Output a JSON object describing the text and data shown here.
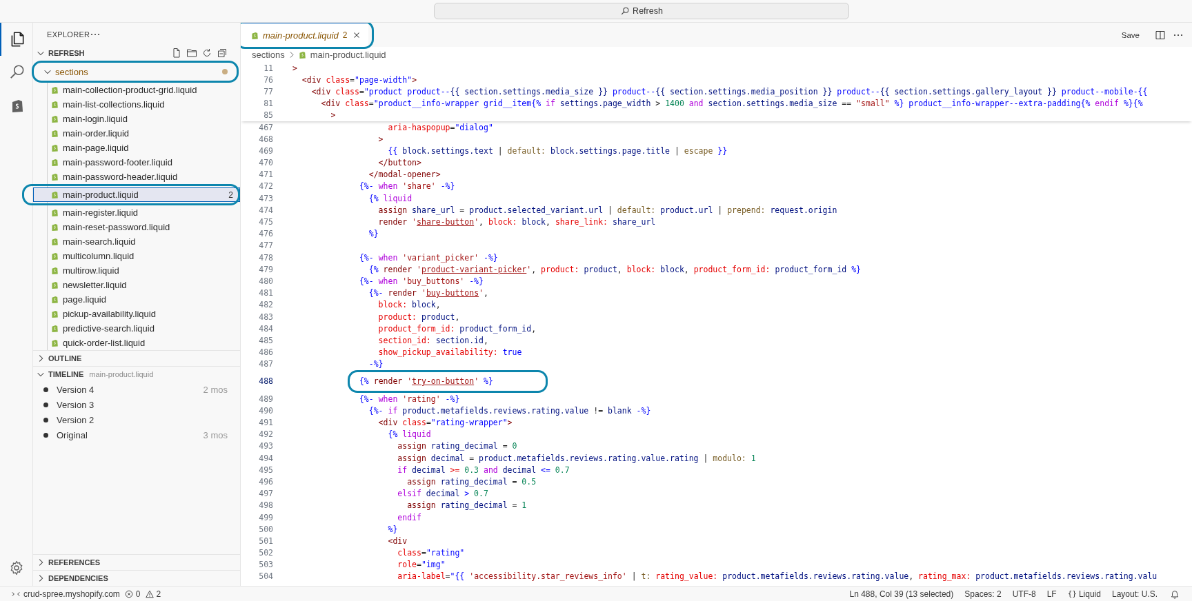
{
  "title_bar": {
    "command_center": "Refresh"
  },
  "activity_bar": {
    "items": [
      {
        "kind": "files",
        "selected": true
      },
      {
        "kind": "search",
        "selected": false
      },
      {
        "kind": "shopify",
        "selected": false
      }
    ]
  },
  "explorer": {
    "title": "EXPLORER",
    "root": {
      "label": "REFRESH",
      "expanded": true
    },
    "folder": {
      "label": "sections",
      "expanded": true,
      "modified": true,
      "circled": true
    },
    "files": [
      {
        "name": "main-collection-product-grid.liquid",
        "selected": false,
        "circled": false
      },
      {
        "name": "main-list-collections.liquid",
        "selected": false,
        "circled": false
      },
      {
        "name": "main-login.liquid",
        "selected": false,
        "circled": false
      },
      {
        "name": "main-order.liquid",
        "selected": false,
        "circled": false
      },
      {
        "name": "main-page.liquid",
        "selected": false,
        "circled": false
      },
      {
        "name": "main-password-footer.liquid",
        "selected": false,
        "circled": false
      },
      {
        "name": "main-password-header.liquid",
        "selected": false,
        "circled": false
      },
      {
        "name": "main-product.liquid",
        "problems": "2",
        "selected": true,
        "circled": true
      },
      {
        "name": "main-register.liquid",
        "selected": false,
        "circled": false
      },
      {
        "name": "main-reset-password.liquid",
        "selected": false,
        "circled": false
      },
      {
        "name": "main-search.liquid",
        "selected": false,
        "circled": false
      },
      {
        "name": "multicolumn.liquid",
        "selected": false,
        "circled": false
      },
      {
        "name": "multirow.liquid",
        "selected": false,
        "circled": false
      },
      {
        "name": "newsletter.liquid",
        "selected": false,
        "circled": false
      },
      {
        "name": "page.liquid",
        "selected": false,
        "circled": false
      },
      {
        "name": "pickup-availability.liquid",
        "selected": false,
        "circled": false
      },
      {
        "name": "predictive-search.liquid",
        "selected": false,
        "circled": false
      },
      {
        "name": "quick-order-list.liquid",
        "selected": false,
        "circled": false
      }
    ]
  },
  "panels": [
    {
      "title": "OUTLINE",
      "expanded": false
    },
    {
      "title": "TIMELINE",
      "subtitle": "main-product.liquid",
      "expanded": true,
      "items": [
        {
          "label": "Version 4",
          "time": "2 mos"
        },
        {
          "label": "Version 3"
        },
        {
          "label": "Version 2"
        },
        {
          "label": "Original",
          "time": "3 mos"
        }
      ]
    },
    {
      "title": "REFERENCES",
      "expanded": false
    },
    {
      "title": "DEPENDENCIES",
      "expanded": false
    }
  ],
  "editor": {
    "tab": {
      "label": "main-product.liquid",
      "problems": "2",
      "preview": true,
      "circled": true
    },
    "save": "Save",
    "breadcrumb": [
      "sections",
      "main-product.liquid"
    ],
    "sticky_lines": [
      {
        "num": "11",
        "tokens": [
          {
            "kind": "tag",
            "text": ">"
          }
        ]
      },
      {
        "num": "76",
        "tokens": [
          {
            "kind": "tag",
            "text": "  <div"
          },
          {
            "kind": "attr",
            "text": " class"
          },
          {
            "kind": "plain",
            "text": "="
          },
          {
            "kind": "string",
            "text": "\"page-width\""
          },
          {
            "kind": "tag",
            "text": ">"
          }
        ]
      },
      {
        "num": "77",
        "tokens": [
          {
            "kind": "tag",
            "text": "    <div"
          },
          {
            "kind": "attr",
            "text": " class"
          },
          {
            "kind": "plain",
            "text": "="
          },
          {
            "kind": "string",
            "text": "\"product product--"
          },
          {
            "kind": "var",
            "text": "{{ section.settings.media_size }}"
          },
          {
            "kind": "string",
            "text": " product--"
          },
          {
            "kind": "var",
            "text": "{{ section.settings.media_position }}"
          },
          {
            "kind": "string",
            "text": " product--"
          },
          {
            "kind": "var",
            "text": "{{ section.settings.gallery_layout }}"
          },
          {
            "kind": "string",
            "text": " product--mobile-"
          },
          {
            "kind": "delim",
            "text": "{{"
          }
        ]
      },
      {
        "num": "81",
        "tokens": [
          {
            "kind": "tag",
            "text": "      <div"
          },
          {
            "kind": "attr",
            "text": " class"
          },
          {
            "kind": "plain",
            "text": "="
          },
          {
            "kind": "string",
            "text": "\"product__info-wrapper grid__item"
          },
          {
            "kind": "delim",
            "text": "{%"
          },
          {
            "kind": "keyword",
            "text": " if"
          },
          {
            "kind": "var",
            "text": " settings.page_width"
          },
          {
            "kind": "plain",
            "text": " > "
          },
          {
            "kind": "number",
            "text": "1400"
          },
          {
            "kind": "keyword",
            "text": " and"
          },
          {
            "kind": "var",
            "text": " section.settings.media_size"
          },
          {
            "kind": "plain",
            "text": " == "
          },
          {
            "kind": "quote",
            "text": "\"small\""
          },
          {
            "kind": "delim",
            "text": " %}"
          },
          {
            "kind": "string",
            "text": " product__info-wrapper--extra-padding"
          },
          {
            "kind": "delim",
            "text": "{%"
          },
          {
            "kind": "keyword",
            "text": " endif"
          },
          {
            "kind": "delim",
            "text": " %}{%"
          }
        ]
      },
      {
        "num": "85",
        "tokens": [
          {
            "kind": "tag",
            "text": "        >"
          }
        ]
      }
    ],
    "lines": [
      {
        "num": "467",
        "current": false,
        "circled": false,
        "tokens": [
          {
            "kind": "attr",
            "text": "                    aria-haspopup"
          },
          {
            "kind": "plain",
            "text": "="
          },
          {
            "kind": "string",
            "text": "\"dialog\""
          }
        ]
      },
      {
        "num": "468",
        "current": false,
        "circled": false,
        "tokens": [
          {
            "kind": "tag",
            "text": "                  >"
          }
        ]
      },
      {
        "num": "469",
        "current": false,
        "circled": false,
        "tokens": [
          {
            "kind": "delim",
            "text": "                    {{"
          },
          {
            "kind": "var",
            "text": " block.settings.text"
          },
          {
            "kind": "plain",
            "text": " | "
          },
          {
            "kind": "filter",
            "text": "default:"
          },
          {
            "kind": "var",
            "text": " block.settings.page.title"
          },
          {
            "kind": "plain",
            "text": " | "
          },
          {
            "kind": "filter",
            "text": "escape"
          },
          {
            "kind": "delim",
            "text": " }}"
          }
        ]
      },
      {
        "num": "470",
        "current": false,
        "circled": false,
        "tokens": [
          {
            "kind": "tag",
            "text": "                  </button>"
          }
        ]
      },
      {
        "num": "471",
        "current": false,
        "circled": false,
        "tokens": [
          {
            "kind": "tag",
            "text": "                </modal-opener>"
          }
        ]
      },
      {
        "num": "472",
        "current": false,
        "circled": false,
        "tokens": [
          {
            "kind": "delim",
            "text": "              {%-"
          },
          {
            "kind": "keyword",
            "text": " when"
          },
          {
            "kind": "quote",
            "text": " 'share'"
          },
          {
            "kind": "delim",
            "text": " -%}"
          }
        ]
      },
      {
        "num": "473",
        "current": false,
        "circled": false,
        "tokens": [
          {
            "kind": "delim",
            "text": "                {%"
          },
          {
            "kind": "keyword",
            "text": " liquid"
          }
        ]
      },
      {
        "num": "474",
        "current": false,
        "circled": false,
        "tokens": [
          {
            "kind": "tag",
            "text": "                  assign"
          },
          {
            "kind": "var",
            "text": " share_url"
          },
          {
            "kind": "plain",
            "text": " = "
          },
          {
            "kind": "var",
            "text": "product.selected_variant.url"
          },
          {
            "kind": "plain",
            "text": " | "
          },
          {
            "kind": "filter",
            "text": "default:"
          },
          {
            "kind": "var",
            "text": " product.url"
          },
          {
            "kind": "plain",
            "text": " | "
          },
          {
            "kind": "filter",
            "text": "prepend:"
          },
          {
            "kind": "var",
            "text": " request.origin"
          }
        ]
      },
      {
        "num": "475",
        "current": false,
        "circled": false,
        "tokens": [
          {
            "kind": "tag",
            "text": "                  render"
          },
          {
            "kind": "quote",
            "text": " '"
          },
          {
            "kind": "link",
            "text": "share-button"
          },
          {
            "kind": "quote",
            "text": "'"
          },
          {
            "kind": "plain",
            "text": ","
          },
          {
            "kind": "attr",
            "text": " block:"
          },
          {
            "kind": "var",
            "text": " block"
          },
          {
            "kind": "plain",
            "text": ","
          },
          {
            "kind": "attr",
            "text": " share_link:"
          },
          {
            "kind": "var",
            "text": " share_url"
          }
        ]
      },
      {
        "num": "476",
        "current": false,
        "circled": false,
        "tokens": [
          {
            "kind": "delim",
            "text": "                %}"
          }
        ]
      },
      {
        "num": "477",
        "current": false,
        "circled": false
      },
      {
        "num": "478",
        "current": false,
        "circled": false,
        "tokens": [
          {
            "kind": "delim",
            "text": "              {%-"
          },
          {
            "kind": "keyword",
            "text": " when"
          },
          {
            "kind": "quote",
            "text": " 'variant_picker'"
          },
          {
            "kind": "delim",
            "text": " -%}"
          }
        ]
      },
      {
        "num": "479",
        "current": false,
        "circled": false,
        "tokens": [
          {
            "kind": "delim",
            "text": "                {%"
          },
          {
            "kind": "tag",
            "text": " render"
          },
          {
            "kind": "quote",
            "text": " '"
          },
          {
            "kind": "link",
            "text": "product-variant-picker"
          },
          {
            "kind": "quote",
            "text": "'"
          },
          {
            "kind": "plain",
            "text": ","
          },
          {
            "kind": "attr",
            "text": " product:"
          },
          {
            "kind": "var",
            "text": " product"
          },
          {
            "kind": "plain",
            "text": ","
          },
          {
            "kind": "attr",
            "text": " block:"
          },
          {
            "kind": "var",
            "text": " block"
          },
          {
            "kind": "plain",
            "text": ","
          },
          {
            "kind": "attr",
            "text": " product_form_id:"
          },
          {
            "kind": "var",
            "text": " product_form_id"
          },
          {
            "kind": "delim",
            "text": " %}"
          }
        ]
      },
      {
        "num": "480",
        "current": false,
        "circled": false,
        "tokens": [
          {
            "kind": "delim",
            "text": "              {%-"
          },
          {
            "kind": "keyword",
            "text": " when"
          },
          {
            "kind": "quote",
            "text": " 'buy_buttons'"
          },
          {
            "kind": "delim",
            "text": " -%}"
          }
        ]
      },
      {
        "num": "481",
        "current": false,
        "circled": false,
        "tokens": [
          {
            "kind": "delim",
            "text": "                {%-"
          },
          {
            "kind": "tag",
            "text": " render"
          },
          {
            "kind": "quote",
            "text": " '"
          },
          {
            "kind": "link",
            "text": "buy-buttons"
          },
          {
            "kind": "quote",
            "text": "'"
          },
          {
            "kind": "plain",
            "text": ","
          }
        ]
      },
      {
        "num": "482",
        "current": false,
        "circled": false,
        "tokens": [
          {
            "kind": "attr",
            "text": "                  block:"
          },
          {
            "kind": "var",
            "text": " block"
          },
          {
            "kind": "plain",
            "text": ","
          }
        ]
      },
      {
        "num": "483",
        "current": false,
        "circled": false,
        "tokens": [
          {
            "kind": "attr",
            "text": "                  product:"
          },
          {
            "kind": "var",
            "text": " product"
          },
          {
            "kind": "plain",
            "text": ","
          }
        ]
      },
      {
        "num": "484",
        "current": false,
        "circled": false,
        "tokens": [
          {
            "kind": "attr",
            "text": "                  product_form_id:"
          },
          {
            "kind": "var",
            "text": " product_form_id"
          },
          {
            "kind": "plain",
            "text": ","
          }
        ]
      },
      {
        "num": "485",
        "current": false,
        "circled": false,
        "tokens": [
          {
            "kind": "attr",
            "text": "                  section_id:"
          },
          {
            "kind": "var",
            "text": " section.id"
          },
          {
            "kind": "plain",
            "text": ","
          }
        ]
      },
      {
        "num": "486",
        "current": false,
        "circled": false,
        "tokens": [
          {
            "kind": "attr",
            "text": "                  show_pickup_availability:"
          },
          {
            "kind": "delim",
            "text": " true"
          }
        ]
      },
      {
        "num": "487",
        "current": false,
        "circled": false,
        "tokens": [
          {
            "kind": "delim",
            "text": "                -%}"
          }
        ]
      },
      {
        "num": "488",
        "current": true,
        "circled": true,
        "tokens": [
          {
            "kind": "delim",
            "text": "              {%"
          },
          {
            "kind": "tag",
            "text": " render"
          },
          {
            "kind": "quote",
            "text": " '"
          },
          {
            "kind": "link",
            "text": "try-on-button"
          },
          {
            "kind": "quote",
            "text": "'"
          },
          {
            "kind": "delim",
            "text": " %}"
          }
        ]
      },
      {
        "num": "489",
        "current": false,
        "circled": false,
        "tokens": [
          {
            "kind": "delim",
            "text": "              {%-"
          },
          {
            "kind": "keyword",
            "text": " when"
          },
          {
            "kind": "quote",
            "text": " 'rating'"
          },
          {
            "kind": "delim",
            "text": " -%}"
          }
        ]
      },
      {
        "num": "490",
        "current": false,
        "circled": false,
        "tokens": [
          {
            "kind": "delim",
            "text": "                {%-"
          },
          {
            "kind": "keyword",
            "text": " if"
          },
          {
            "kind": "var",
            "text": " product.metafields.reviews.rating.value"
          },
          {
            "kind": "plain",
            "text": " != "
          },
          {
            "kind": "var",
            "text": "blank"
          },
          {
            "kind": "delim",
            "text": " -%}"
          }
        ]
      },
      {
        "num": "491",
        "current": false,
        "circled": false,
        "tokens": [
          {
            "kind": "tag",
            "text": "                  <div"
          },
          {
            "kind": "attr",
            "text": " class"
          },
          {
            "kind": "plain",
            "text": "="
          },
          {
            "kind": "string",
            "text": "\"rating-wrapper\""
          },
          {
            "kind": "tag",
            "text": ">"
          }
        ]
      },
      {
        "num": "492",
        "current": false,
        "circled": false,
        "tokens": [
          {
            "kind": "delim",
            "text": "                    {%"
          },
          {
            "kind": "keyword",
            "text": " liquid"
          }
        ]
      },
      {
        "num": "493",
        "current": false,
        "circled": false,
        "tokens": [
          {
            "kind": "tag",
            "text": "                      assign"
          },
          {
            "kind": "var",
            "text": " rating_decimal"
          },
          {
            "kind": "plain",
            "text": " = "
          },
          {
            "kind": "number",
            "text": "0"
          }
        ]
      },
      {
        "num": "494",
        "current": false,
        "circled": false,
        "tokens": [
          {
            "kind": "tag",
            "text": "                      assign"
          },
          {
            "kind": "var",
            "text": " decimal"
          },
          {
            "kind": "plain",
            "text": " = "
          },
          {
            "kind": "var",
            "text": "product.metafields.reviews.rating.value.rating"
          },
          {
            "kind": "plain",
            "text": " | "
          },
          {
            "kind": "filter",
            "text": "modulo:"
          },
          {
            "kind": "number",
            "text": " 1"
          }
        ]
      },
      {
        "num": "495",
        "current": false,
        "circled": false,
        "tokens": [
          {
            "kind": "keyword",
            "text": "                      if"
          },
          {
            "kind": "var",
            "text": " decimal"
          },
          {
            "kind": "attr",
            "text": " >="
          },
          {
            "kind": "number",
            "text": " 0.3"
          },
          {
            "kind": "keyword",
            "text": " and"
          },
          {
            "kind": "var",
            "text": " decimal"
          },
          {
            "kind": "delim",
            "text": " <="
          },
          {
            "kind": "number",
            "text": " 0.7"
          }
        ]
      },
      {
        "num": "496",
        "current": false,
        "circled": false,
        "tokens": [
          {
            "kind": "tag",
            "text": "                        assign"
          },
          {
            "kind": "var",
            "text": " rating_decimal"
          },
          {
            "kind": "plain",
            "text": " = "
          },
          {
            "kind": "number",
            "text": "0.5"
          }
        ]
      },
      {
        "num": "497",
        "current": false,
        "circled": false,
        "tokens": [
          {
            "kind": "keyword",
            "text": "                      elsif"
          },
          {
            "kind": "var",
            "text": " decimal"
          },
          {
            "kind": "delim",
            "text": " >"
          },
          {
            "kind": "number",
            "text": " 0.7"
          }
        ]
      },
      {
        "num": "498",
        "current": false,
        "circled": false,
        "tokens": [
          {
            "kind": "tag",
            "text": "                        assign"
          },
          {
            "kind": "var",
            "text": " rating_decimal"
          },
          {
            "kind": "plain",
            "text": " = "
          },
          {
            "kind": "number",
            "text": "1"
          }
        ]
      },
      {
        "num": "499",
        "current": false,
        "circled": false,
        "tokens": [
          {
            "kind": "keyword",
            "text": "                      endif"
          }
        ]
      },
      {
        "num": "500",
        "current": false,
        "circled": false,
        "tokens": [
          {
            "kind": "delim",
            "text": "                    %}"
          }
        ]
      },
      {
        "num": "501",
        "current": false,
        "circled": false,
        "tokens": [
          {
            "kind": "tag",
            "text": "                    <div"
          }
        ]
      },
      {
        "num": "502",
        "current": false,
        "circled": false,
        "tokens": [
          {
            "kind": "attr",
            "text": "                      class"
          },
          {
            "kind": "plain",
            "text": "="
          },
          {
            "kind": "string",
            "text": "\"rating\""
          }
        ]
      },
      {
        "num": "503",
        "current": false,
        "circled": false,
        "tokens": [
          {
            "kind": "attr",
            "text": "                      role"
          },
          {
            "kind": "plain",
            "text": "="
          },
          {
            "kind": "string",
            "text": "\"img\""
          }
        ]
      },
      {
        "num": "504",
        "current": false,
        "circled": false,
        "tokens": [
          {
            "kind": "attr",
            "text": "                      aria-label"
          },
          {
            "kind": "plain",
            "text": "="
          },
          {
            "kind": "string",
            "text": "\""
          },
          {
            "kind": "delim",
            "text": "{{"
          },
          {
            "kind": "quote",
            "text": " 'accessibility.star_reviews_info'"
          },
          {
            "kind": "plain",
            "text": " | "
          },
          {
            "kind": "filter",
            "text": "t:"
          },
          {
            "kind": "attr",
            "text": " rating_value:"
          },
          {
            "kind": "var",
            "text": " product.metafields.reviews.rating.value"
          },
          {
            "kind": "plain",
            "text": ","
          },
          {
            "kind": "attr",
            "text": " rating_max:"
          },
          {
            "kind": "var",
            "text": " product.metafields.reviews.rating.valu"
          }
        ]
      }
    ]
  },
  "status_bar": {
    "remote": "crud-spree.myshopify.com",
    "errors": "0",
    "warnings": "2",
    "items": [
      "Ln 488, Col 39 (13 selected)",
      "Spaces: 2",
      "UTF-8",
      "LF"
    ],
    "language": {
      "icon": "{}",
      "label": "Liquid"
    },
    "layout": "Layout: U.S."
  }
}
